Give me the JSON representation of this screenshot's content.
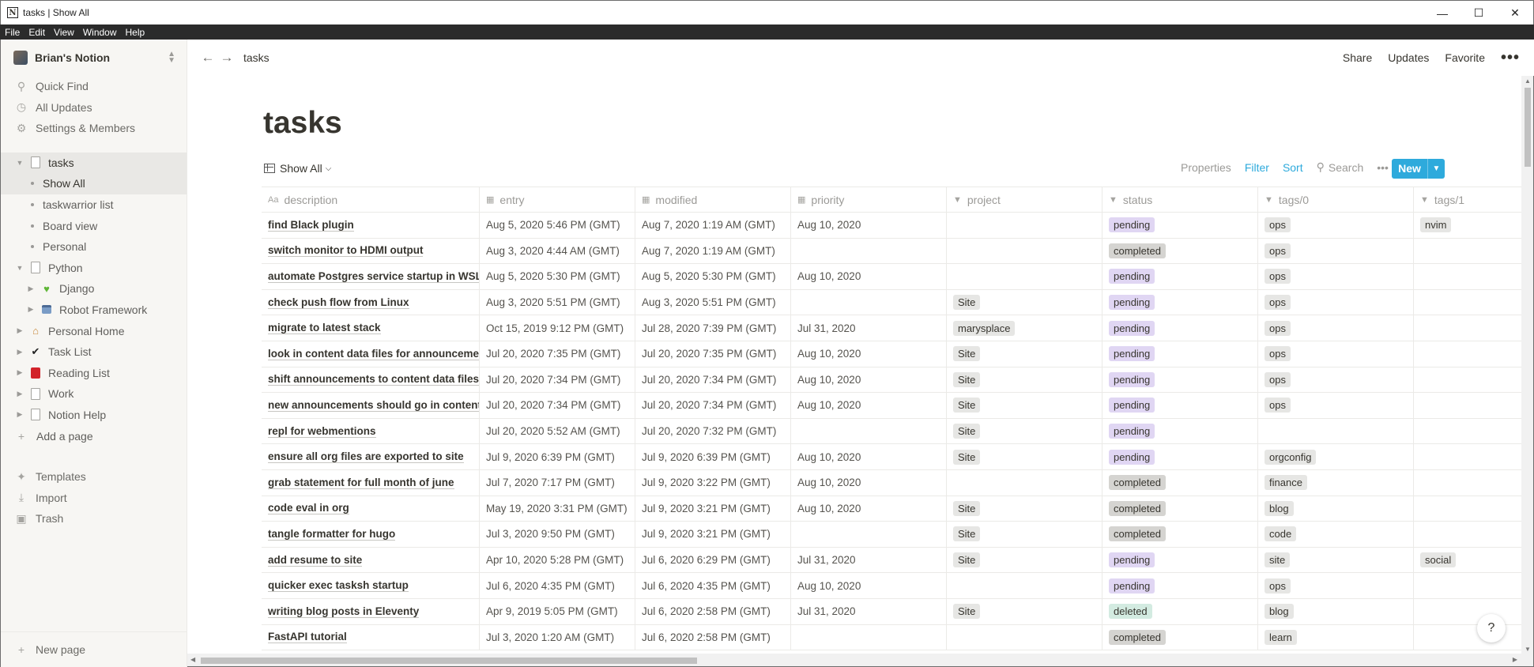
{
  "window": {
    "title": "tasks | Show All"
  },
  "menu": [
    "File",
    "Edit",
    "View",
    "Window",
    "Help"
  ],
  "sidebar": {
    "workspace": "Brian's Notion",
    "nav": [
      {
        "label": "Quick Find",
        "icon": "search-icon"
      },
      {
        "label": "All Updates",
        "icon": "clock-icon"
      },
      {
        "label": "Settings & Members",
        "icon": "gear-icon"
      }
    ],
    "tree": [
      {
        "label": "tasks",
        "icon": "page-icon",
        "level": 0,
        "expanded": true
      },
      {
        "label": "Show All",
        "level": 1,
        "selected": true
      },
      {
        "label": "taskwarrior list",
        "level": 1
      },
      {
        "label": "Board view",
        "level": 1
      },
      {
        "label": "Personal",
        "level": 1
      },
      {
        "label": "Python",
        "icon": "page-icon",
        "level": 0,
        "expanded": true
      },
      {
        "label": "Django",
        "icon": "green-heart-icon",
        "level": 1
      },
      {
        "label": "Robot Framework",
        "icon": "robot-icon",
        "level": 1
      },
      {
        "label": "Personal Home",
        "icon": "house-icon",
        "level": 0
      },
      {
        "label": "Task List",
        "icon": "checkmark-icon",
        "level": 0
      },
      {
        "label": "Reading List",
        "icon": "book-icon",
        "level": 0
      },
      {
        "label": "Work",
        "icon": "page-icon",
        "level": 0
      },
      {
        "label": "Notion Help",
        "icon": "page-icon",
        "level": 0
      }
    ],
    "add_page": "Add a page",
    "bottom": [
      {
        "label": "Templates",
        "icon": "templates-icon"
      },
      {
        "label": "Import",
        "icon": "import-icon"
      },
      {
        "label": "Trash",
        "icon": "trash-icon"
      }
    ],
    "new_page": "New page"
  },
  "topbar": {
    "breadcrumb": "tasks",
    "share": "Share",
    "updates": "Updates",
    "favorite": "Favorite"
  },
  "page": {
    "title": "tasks",
    "view": "Show All",
    "actions": {
      "properties": "Properties",
      "filter": "Filter",
      "sort": "Sort",
      "search": "Search",
      "new": "New"
    }
  },
  "table": {
    "columns": [
      {
        "label": "description",
        "icon": "Aa"
      },
      {
        "label": "entry",
        "icon": "date-icon"
      },
      {
        "label": "modified",
        "icon": "date-icon"
      },
      {
        "label": "priority",
        "icon": "date-icon"
      },
      {
        "label": "project",
        "icon": "select-icon"
      },
      {
        "label": "status",
        "icon": "select-icon"
      },
      {
        "label": "tags/0",
        "icon": "select-icon"
      },
      {
        "label": "tags/1",
        "icon": "select-icon"
      }
    ],
    "rows": [
      [
        "find Black plugin",
        "Aug 5, 2020 5:46 PM (GMT)",
        "Aug 7, 2020 1:19 AM (GMT)",
        "Aug 10, 2020",
        "",
        "pending",
        "ops",
        "nvim"
      ],
      [
        "switch monitor to HDMI output",
        "Aug 3, 2020 4:44 AM (GMT)",
        "Aug 7, 2020 1:19 AM (GMT)",
        "",
        "",
        "completed",
        "ops",
        ""
      ],
      [
        "automate Postgres service startup in WSL",
        "Aug 5, 2020 5:30 PM (GMT)",
        "Aug 5, 2020 5:30 PM (GMT)",
        "Aug 10, 2020",
        "",
        "pending",
        "ops",
        ""
      ],
      [
        "check push flow from Linux",
        "Aug 3, 2020 5:51 PM (GMT)",
        "Aug 3, 2020 5:51 PM (GMT)",
        "",
        "Site",
        "pending",
        "ops",
        ""
      ],
      [
        "migrate to latest stack",
        "Oct 15, 2019 9:12 PM (GMT)",
        "Jul 28, 2020 7:39 PM (GMT)",
        "Jul 31, 2020",
        "marysplace",
        "pending",
        "ops",
        ""
      ],
      [
        "look in content data files for announcemer",
        "Jul 20, 2020 7:35 PM (GMT)",
        "Jul 20, 2020 7:35 PM (GMT)",
        "Aug 10, 2020",
        "Site",
        "pending",
        "ops",
        ""
      ],
      [
        "shift announcements to content data files",
        "Jul 20, 2020 7:34 PM (GMT)",
        "Jul 20, 2020 7:34 PM (GMT)",
        "Aug 10, 2020",
        "Site",
        "pending",
        "ops",
        ""
      ],
      [
        "new announcements should go in content",
        "Jul 20, 2020 7:34 PM (GMT)",
        "Jul 20, 2020 7:34 PM (GMT)",
        "Aug 10, 2020",
        "Site",
        "pending",
        "ops",
        ""
      ],
      [
        "repl for webmentions",
        "Jul 20, 2020 5:52 AM (GMT)",
        "Jul 20, 2020 7:32 PM (GMT)",
        "",
        "Site",
        "pending",
        "",
        ""
      ],
      [
        "ensure all org files are exported to site",
        "Jul 9, 2020 6:39 PM (GMT)",
        "Jul 9, 2020 6:39 PM (GMT)",
        "Aug 10, 2020",
        "Site",
        "pending",
        "orgconfig",
        ""
      ],
      [
        "grab statement for full month of june",
        "Jul 7, 2020 7:17 PM (GMT)",
        "Jul 9, 2020 3:22 PM (GMT)",
        "Aug 10, 2020",
        "",
        "completed",
        "finance",
        ""
      ],
      [
        "code eval in org",
        "May 19, 2020 3:31 PM (GMT)",
        "Jul 9, 2020 3:21 PM (GMT)",
        "Aug 10, 2020",
        "Site",
        "completed",
        "blog",
        ""
      ],
      [
        "tangle formatter for hugo",
        "Jul 3, 2020 9:50 PM (GMT)",
        "Jul 9, 2020 3:21 PM (GMT)",
        "",
        "Site",
        "completed",
        "code",
        ""
      ],
      [
        "add resume to site",
        "Apr 10, 2020 5:28 PM (GMT)",
        "Jul 6, 2020 6:29 PM (GMT)",
        "Jul 31, 2020",
        "Site",
        "pending",
        "site",
        "social"
      ],
      [
        "quicker exec tasksh startup",
        "Jul 6, 2020 4:35 PM (GMT)",
        "Jul 6, 2020 4:35 PM (GMT)",
        "Aug 10, 2020",
        "",
        "pending",
        "ops",
        ""
      ],
      [
        "writing blog posts in Eleventy",
        "Apr 9, 2019 5:05 PM (GMT)",
        "Jul 6, 2020 2:58 PM (GMT)",
        "Jul 31, 2020",
        "Site",
        "deleted",
        "blog",
        ""
      ],
      [
        "FastAPI tutorial",
        "Jul 3, 2020 1:20 AM (GMT)",
        "Jul 6, 2020 2:58 PM (GMT)",
        "",
        "",
        "completed",
        "learn",
        ""
      ]
    ]
  },
  "help_label": "?"
}
